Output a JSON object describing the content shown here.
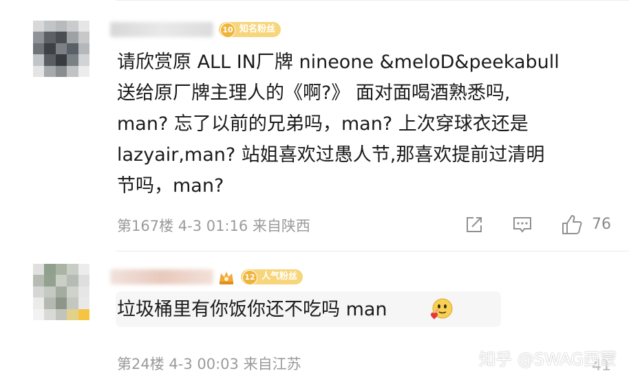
{
  "comments": [
    {
      "badge_level": "10",
      "badge_label": "知名粉丝",
      "lines": [
        "请欣赏原 ALL IN厂牌 nineone &meloD&peekabull",
        "送给原厂牌主理人的《啊?》 面对面喝酒熟悉吗,",
        "man? 忘了以前的兄弟吗，man? 上次穿球衣还是",
        "lazyair,man? 站姐喜欢过愚人节,那喜欢提前过清明",
        "节吗，man?"
      ],
      "meta": "第167楼 4-3 01:16 来自陕西",
      "like_count": "76",
      "icons": [
        "share-icon",
        "comment-icon",
        "like-icon"
      ]
    },
    {
      "badge_level": "12",
      "badge_label": "人气粉丝",
      "text": "垃圾桶里有你饭你还不吃吗 man",
      "emoji": "love-face-emoji",
      "meta": "第24楼 4-3 00:03 来自江苏",
      "like_count": "41"
    }
  ],
  "watermark": "知乎 @SWAG西蒙",
  "colors": {
    "badge": "#f7d57a",
    "badge_level": "#f0b43c",
    "meta": "#9a9a9a",
    "text": "#1a1a1a"
  }
}
